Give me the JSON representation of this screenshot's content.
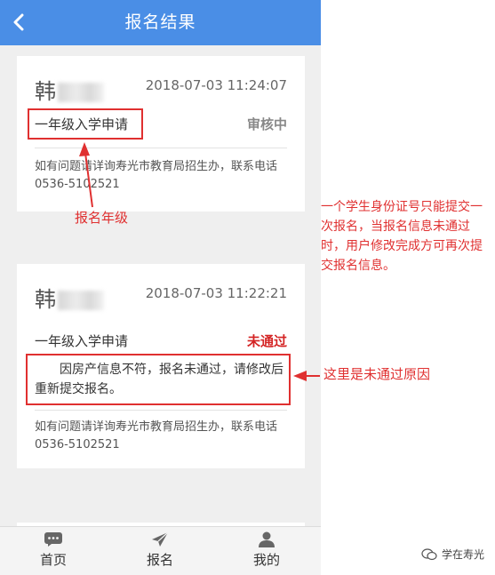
{
  "header": {
    "title": "报名结果"
  },
  "cards": [
    {
      "name": "韩",
      "datetime": "2018-07-03 11:24:07",
      "grade": "一年级入学申请",
      "status": "审核中",
      "contact": "如有问题请详询寿光市教育局招生办，联系电话 0536-5102521"
    },
    {
      "name": "韩",
      "datetime": "2018-07-03 11:22:21",
      "grade": "一年级入学申请",
      "status": "未通过",
      "reason": "因房产信息不符，报名未通过，请修改后重新提交报名。",
      "contact": "如有问题请详询寿光市教育局招生办，联系电话 0536-5102521"
    }
  ],
  "tabbar": {
    "tabs": [
      {
        "label": "首页",
        "icon": "chat-icon"
      },
      {
        "label": "报名",
        "icon": "send-icon"
      },
      {
        "label": "我的",
        "icon": "user-icon"
      }
    ]
  },
  "annotations": {
    "grade_note": "报名年级",
    "side_note": "一个学生身份证号只能提交一次报名，当报名信息未通过时，用户修改完成方可再次提交报名信息。",
    "reason_note": "这里是未通过原因"
  },
  "watermark": "学在寿光",
  "colors": {
    "header": "#4a8ee6",
    "status_pending": "#888888",
    "status_rejected": "#d42424",
    "annotation": "#e03030"
  }
}
